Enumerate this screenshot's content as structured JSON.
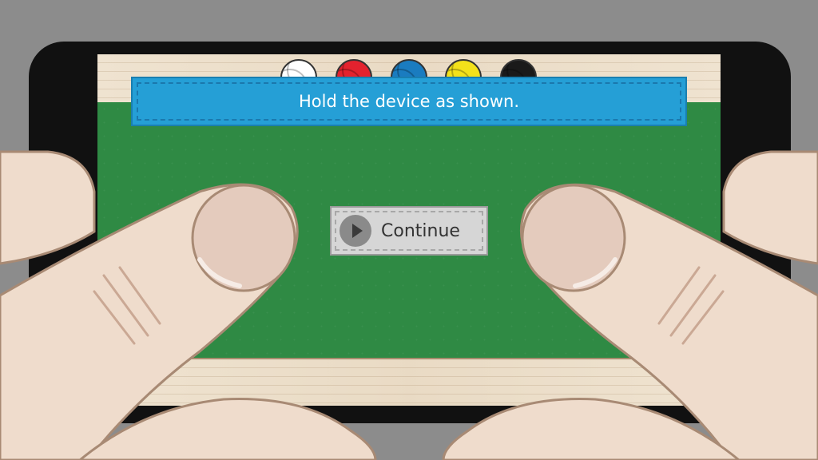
{
  "game": {
    "instruction": "Hold the device as shown.",
    "continue_label": "Continue",
    "yarn_colors": [
      "#ffffff",
      "#e3222e",
      "#1a7cc0",
      "#f3e11a",
      "#1a1a1a"
    ]
  },
  "icons": {
    "play": "play-icon",
    "yarn": "yarn-ball-icon"
  },
  "colors": {
    "felt": "#2f8a44",
    "banner": "#259fd6",
    "wood": "#efe3d0",
    "skin": "#efdccc",
    "background": "#8c8c8c"
  }
}
